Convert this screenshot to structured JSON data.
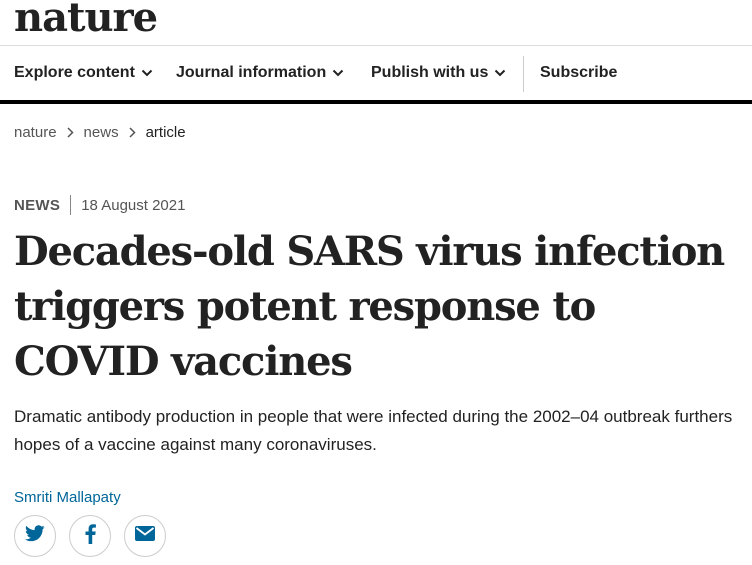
{
  "site": {
    "logo": "nature"
  },
  "nav": {
    "items": [
      {
        "label": "Explore content",
        "has_dropdown": true
      },
      {
        "label": "Journal information",
        "has_dropdown": true
      },
      {
        "label": "Publish with us",
        "has_dropdown": true
      }
    ],
    "subscribe": "Subscribe"
  },
  "breadcrumb": [
    "nature",
    "news",
    "article"
  ],
  "article": {
    "type": "NEWS",
    "date": "18 August 2021",
    "title": "Decades-old SARS virus infection triggers potent response to COVID vaccines",
    "standfirst": "Dramatic antibody production in people that were infected during the 2002–04 outbreak furthers hopes of a vaccine against many coronaviruses.",
    "author": "Smriti Mallapaty"
  },
  "share": {
    "icons": [
      "twitter-icon",
      "facebook-icon",
      "email-icon"
    ]
  },
  "colors": {
    "accent": "#006699",
    "text": "#222222",
    "muted": "#555555"
  }
}
